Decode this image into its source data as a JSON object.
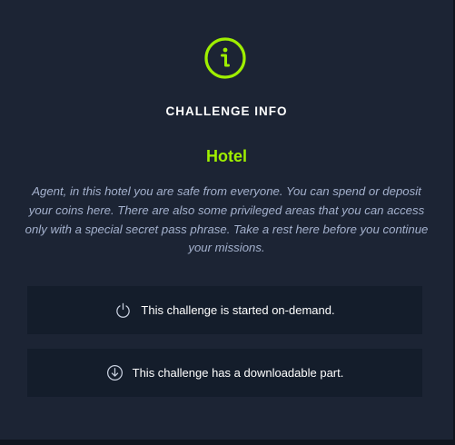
{
  "header": {
    "icon": "info-icon",
    "title": "CHALLENGE INFO"
  },
  "challenge": {
    "name": "Hotel",
    "description": "Agent, in this hotel you are safe from everyone. You can spend or deposit your coins here. There are also some privileged areas that you can access only with a special secret pass phrase. Take a rest here before you continue your missions."
  },
  "features": {
    "on_demand": {
      "icon": "power-icon",
      "label": "This challenge is started on-demand."
    },
    "downloadable": {
      "icon": "download-icon",
      "label": "This challenge has a downloadable part."
    }
  },
  "colors": {
    "accent": "#9fef00",
    "panel_bg": "#1c2434",
    "box_bg": "#141d2b",
    "muted_text": "#a4b1cd"
  }
}
